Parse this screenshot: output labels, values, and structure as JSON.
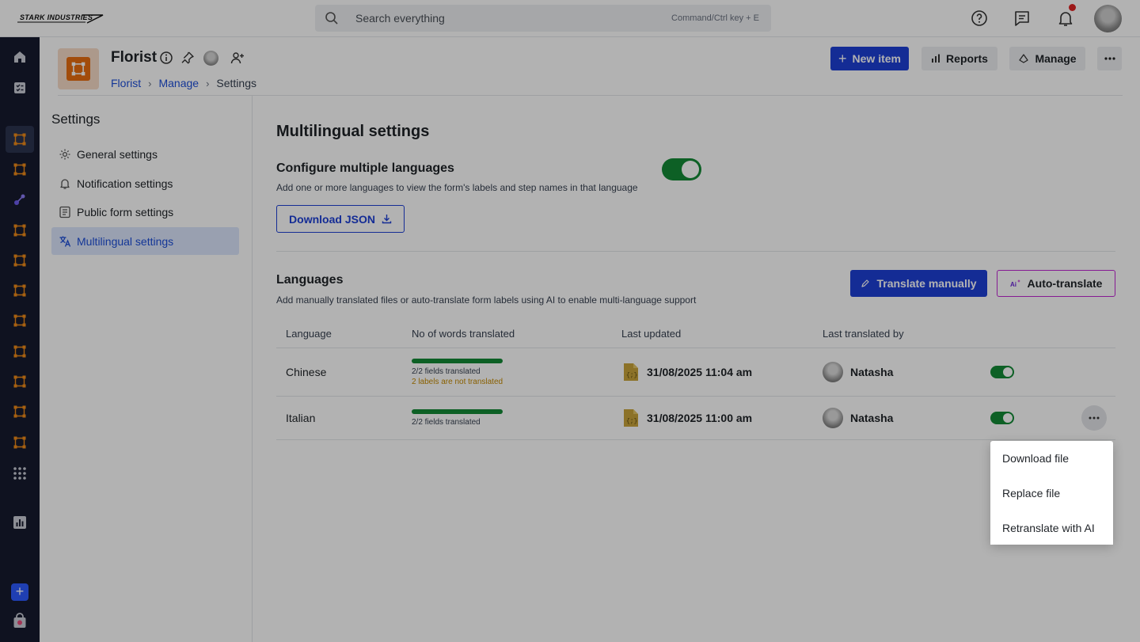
{
  "brand": {
    "logo_text": "STARK INDUSTRIES"
  },
  "search": {
    "placeholder": "Search everything",
    "shortcut_hint": "Command/Ctrl key + E"
  },
  "app": {
    "title": "Florist",
    "accent_color": "#e86e10"
  },
  "breadcrumb": {
    "items": [
      "Florist",
      "Manage",
      "Settings"
    ]
  },
  "header_actions": {
    "new_item": "New item",
    "reports": "Reports",
    "manage": "Manage"
  },
  "settings_nav": {
    "heading": "Settings",
    "items": [
      {
        "label": "General settings",
        "icon": "gear-icon"
      },
      {
        "label": "Notification settings",
        "icon": "bell-icon"
      },
      {
        "label": "Public form settings",
        "icon": "form-icon"
      },
      {
        "label": "Multilingual settings",
        "icon": "translate-icon",
        "active": true
      }
    ]
  },
  "main": {
    "title": "Multilingual settings",
    "configure": {
      "title": "Configure multiple languages",
      "description": "Add one or more languages to view the form's labels and step names in that language",
      "enabled": true,
      "download_label": "Download JSON"
    },
    "languages": {
      "title": "Languages",
      "description": "Add manually translated files or auto-translate form labels using AI to enable multi-language support",
      "translate_manually": "Translate manually",
      "auto_translate": "Auto-translate",
      "columns": [
        "Language",
        "No of words translated",
        "Last updated",
        "Last translated by"
      ],
      "rows": [
        {
          "language": "Chinese",
          "progress": 1.0,
          "fields_text": "2/2 fields translated",
          "warning": "2 labels are not translated",
          "last_updated": "31/08/2025 11:04 am",
          "translated_by": "Natasha",
          "enabled": true
        },
        {
          "language": "Italian",
          "progress": 1.0,
          "fields_text": "2/2 fields translated",
          "warning": "",
          "last_updated": "31/08/2025 11:00 am",
          "translated_by": "Natasha",
          "enabled": true
        }
      ]
    }
  },
  "row_menu": {
    "items": [
      "Download file",
      "Replace file",
      "Retranslate with AI"
    ]
  },
  "colors": {
    "primary": "#1d3fd6",
    "toggle_on": "#138a36",
    "rail_bg": "#161b2e",
    "warning": "#c58a00",
    "notification": "#e02424"
  }
}
